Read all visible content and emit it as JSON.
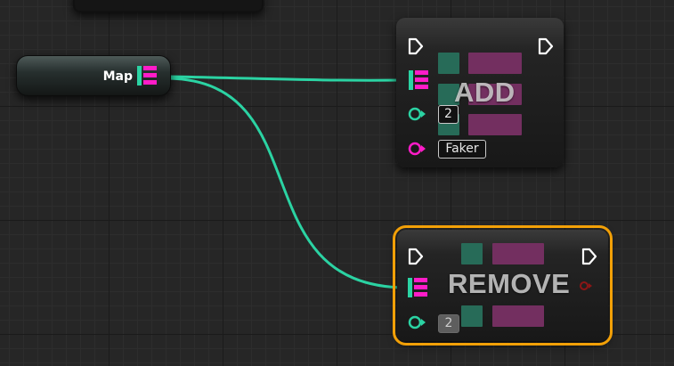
{
  "graph": {
    "accent_color": "#f2a007",
    "wire_color": "#2bd3a3",
    "map_pin_color": "#ff1cc8",
    "background_color": "#262626"
  },
  "map_node": {
    "label": "Map"
  },
  "add_node": {
    "title": "ADD",
    "key_value": "2",
    "value_value": "Faker"
  },
  "remove_node": {
    "title": "REMOVE",
    "key_value": "2",
    "selected": true
  }
}
